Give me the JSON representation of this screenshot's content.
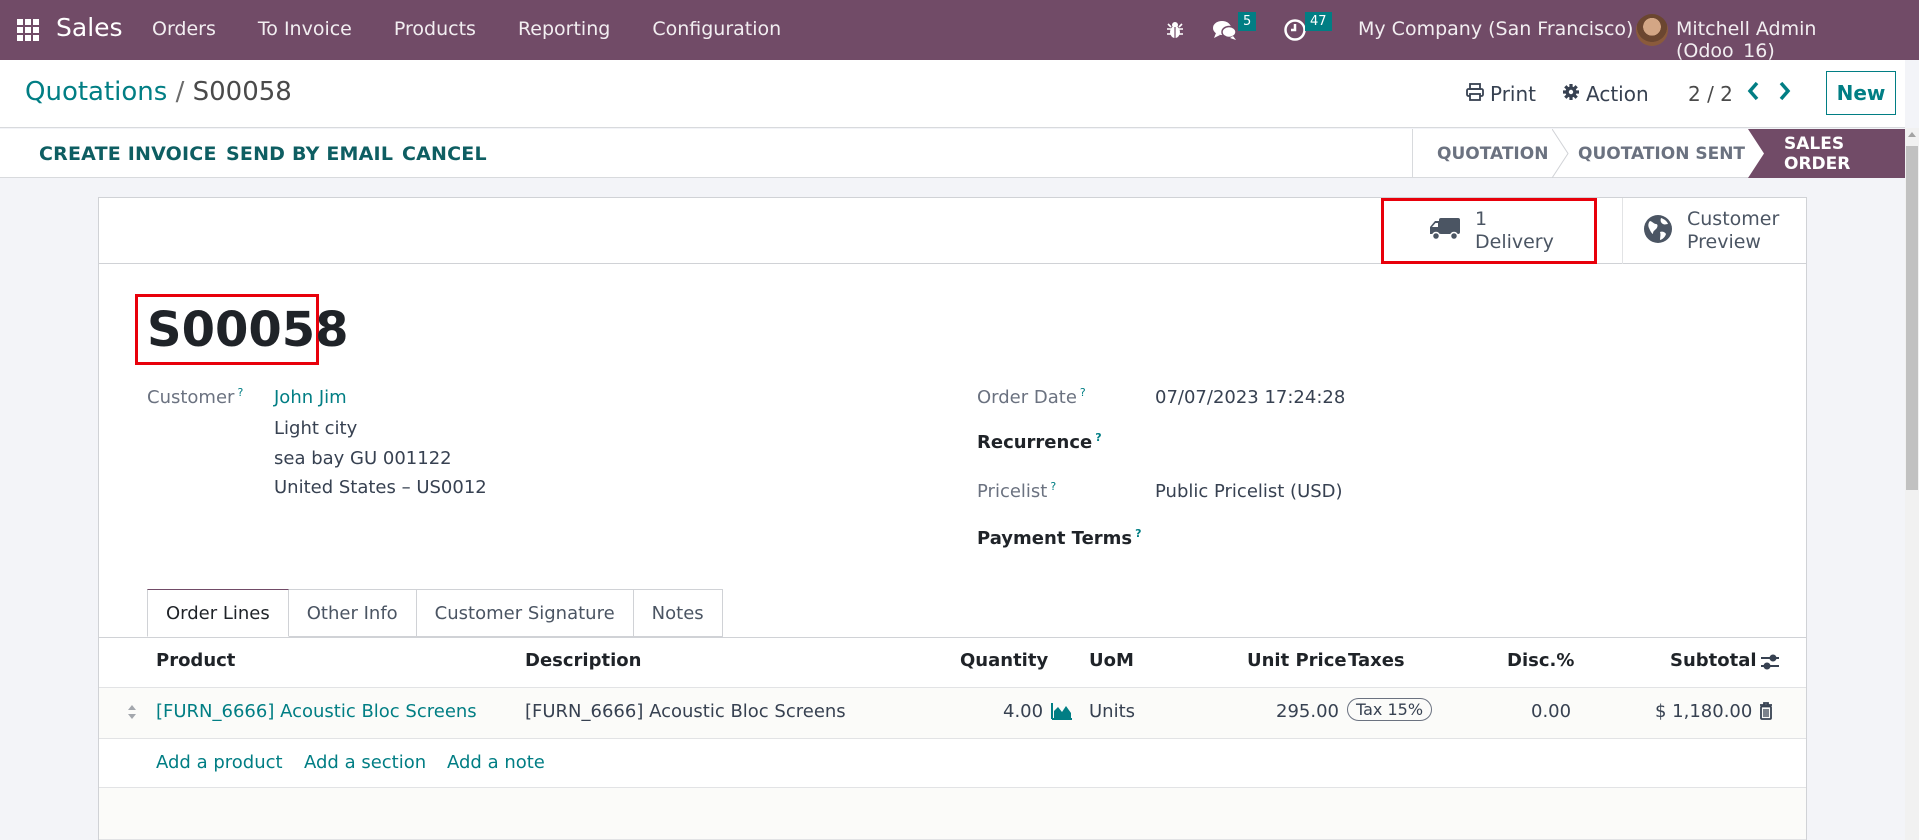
{
  "navbar": {
    "app_name": "Sales",
    "menu": [
      "Orders",
      "To Invoice",
      "Products",
      "Reporting",
      "Configuration"
    ],
    "messages_count": "5",
    "activities_count": "47",
    "company": "My Company (San Francisco)",
    "user": "Mitchell Admin (Odoo_16)"
  },
  "control": {
    "breadcrumb_parent": "Quotations",
    "breadcrumb_sep": "/",
    "breadcrumb_current": "S00058",
    "print_label": "Print",
    "action_label": "Action",
    "pager": "2 / 2",
    "new_label": "New"
  },
  "actions": [
    "CREATE INVOICE",
    "SEND BY EMAIL",
    "CANCEL"
  ],
  "stages": {
    "items": [
      "QUOTATION",
      "QUOTATION SENT",
      "SALES ORDER"
    ],
    "active": "SALES ORDER"
  },
  "smart_buttons": {
    "delivery_count": "1",
    "delivery_label": "Delivery",
    "preview_line1": "Customer",
    "preview_line2": "Preview"
  },
  "record": {
    "reference": "S00058",
    "customer_label": "Customer",
    "customer_name": "John Jim",
    "address": [
      "Light city",
      "sea bay GU 001122",
      "United States – US0012"
    ],
    "order_date_label": "Order Date",
    "order_date": "07/07/2023 17:24:28",
    "recurrence_label": "Recurrence",
    "pricelist_label": "Pricelist",
    "pricelist": "Public Pricelist (USD)",
    "payment_terms_label": "Payment Terms",
    "help_marker": "?"
  },
  "tabs": [
    "Order Lines",
    "Other Info",
    "Customer Signature",
    "Notes"
  ],
  "order_lines": {
    "columns": [
      "Product",
      "Description",
      "Quantity",
      "UoM",
      "Unit Price",
      "Taxes",
      "Disc.%",
      "Subtotal"
    ],
    "rows": [
      {
        "product": "[FURN_6666] Acoustic Bloc Screens",
        "description": "[FURN_6666] Acoustic Bloc Screens",
        "quantity": "4.00",
        "uom": "Units",
        "unit_price": "295.00",
        "taxes": "Tax 15%",
        "discount": "0.00",
        "subtotal": "$ 1,180.00"
      }
    ],
    "add_links": [
      "Add a product",
      "Add a section",
      "Add a note"
    ]
  },
  "colors": {
    "brand": "#714b67",
    "accent": "#017e84",
    "highlight": "#e8000b"
  }
}
